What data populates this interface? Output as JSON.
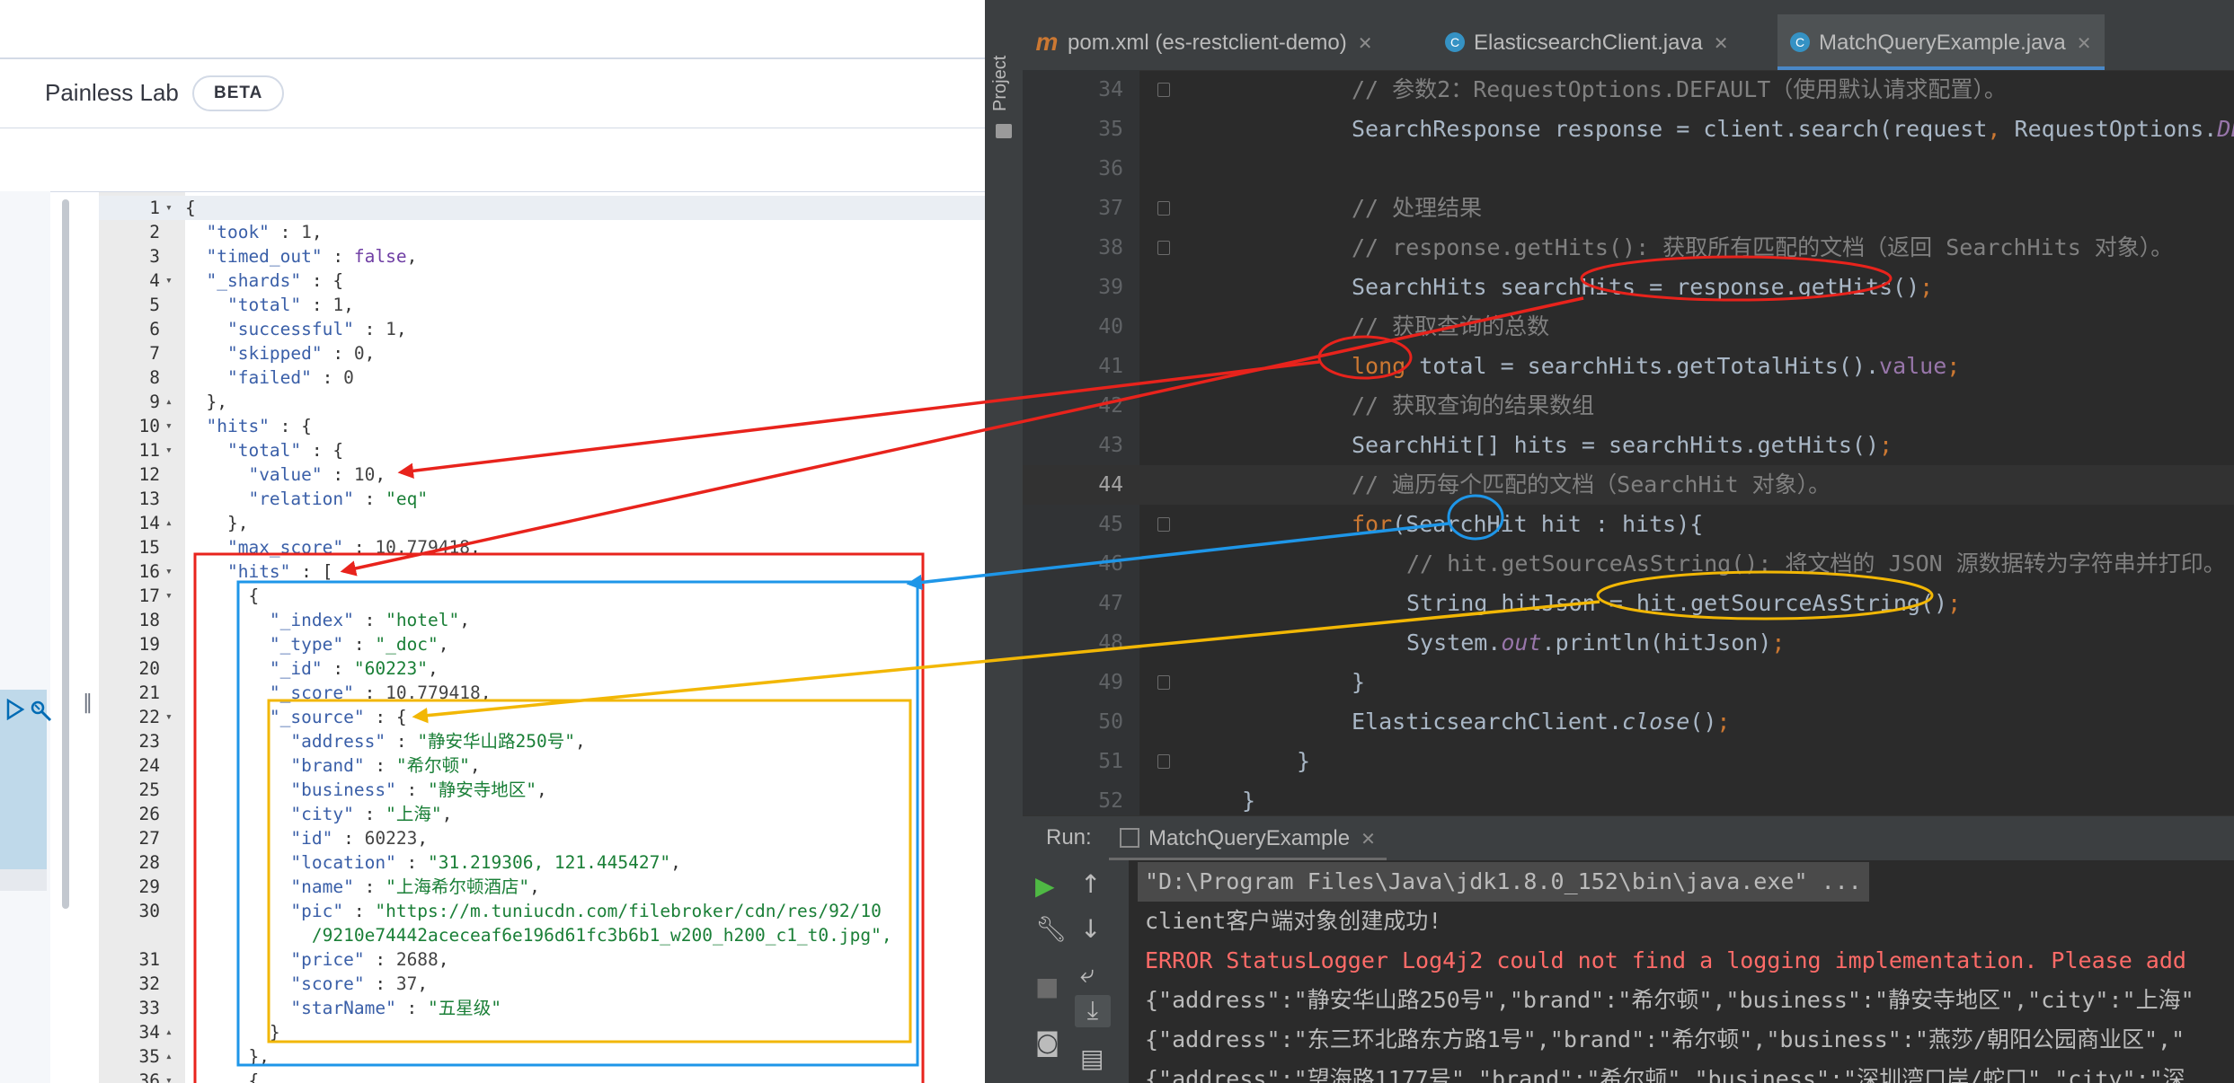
{
  "kibana": {
    "app_title": "Painless Lab",
    "beta_badge": "BETA",
    "code_lines": [
      {
        "n": "1",
        "fold": "▾",
        "t": "{"
      },
      {
        "n": "2",
        "t": "  \"took\" : 1,"
      },
      {
        "n": "3",
        "t": "  \"timed_out\" : false,"
      },
      {
        "n": "4",
        "fold": "▾",
        "t": "  \"_shards\" : {"
      },
      {
        "n": "5",
        "t": "    \"total\" : 1,"
      },
      {
        "n": "6",
        "t": "    \"successful\" : 1,"
      },
      {
        "n": "7",
        "t": "    \"skipped\" : 0,"
      },
      {
        "n": "8",
        "t": "    \"failed\" : 0"
      },
      {
        "n": "9",
        "fold": "▴",
        "t": "  },"
      },
      {
        "n": "10",
        "fold": "▾",
        "t": "  \"hits\" : {"
      },
      {
        "n": "11",
        "fold": "▾",
        "t": "    \"total\" : {"
      },
      {
        "n": "12",
        "t": "      \"value\" : 10,"
      },
      {
        "n": "13",
        "t": "      \"relation\" : \"eq\""
      },
      {
        "n": "14",
        "fold": "▴",
        "t": "    },"
      },
      {
        "n": "15",
        "t": "    \"max_score\" : 10.779418,"
      },
      {
        "n": "16",
        "fold": "▾",
        "t": "    \"hits\" : ["
      },
      {
        "n": "17",
        "fold": "▾",
        "t": "      {"
      },
      {
        "n": "18",
        "t": "        \"_index\" : \"hotel\","
      },
      {
        "n": "19",
        "t": "        \"_type\" : \"_doc\","
      },
      {
        "n": "20",
        "t": "        \"_id\" : \"60223\","
      },
      {
        "n": "21",
        "t": "        \"_score\" : 10.779418,"
      },
      {
        "n": "22",
        "fold": "▾",
        "t": "        \"_source\" : {"
      },
      {
        "n": "23",
        "t": "          \"address\" : \"静安华山路250号\","
      },
      {
        "n": "24",
        "t": "          \"brand\" : \"希尔顿\","
      },
      {
        "n": "25",
        "t": "          \"business\" : \"静安寺地区\","
      },
      {
        "n": "26",
        "t": "          \"city\" : \"上海\","
      },
      {
        "n": "27",
        "t": "          \"id\" : 60223,"
      },
      {
        "n": "28",
        "t": "          \"location\" : \"31.219306, 121.445427\","
      },
      {
        "n": "29",
        "t": "          \"name\" : \"上海希尔顿酒店\","
      },
      {
        "n": "30",
        "t": "          \"pic\" : \"https://m.tuniucdn.com/filebroker/cdn/res/92/10"
      },
      {
        "n": "",
        "t": "            /9210e74442aceceaf6e196d61fc3b6b1_w200_h200_c1_t0.jpg\","
      },
      {
        "n": "31",
        "t": "          \"price\" : 2688,"
      },
      {
        "n": "32",
        "t": "          \"score\" : 37,"
      },
      {
        "n": "33",
        "t": "          \"starName\" : \"五星级\""
      },
      {
        "n": "34",
        "fold": "▴",
        "t": "        }"
      },
      {
        "n": "35",
        "fold": "▴",
        "t": "      },"
      },
      {
        "n": "36",
        "fold": "▾",
        "t": "      {"
      }
    ]
  },
  "ide": {
    "project_label": "Project",
    "tabs": [
      {
        "icon": "m",
        "label": "pom.xml (es-restclient-demo)",
        "selected": false
      },
      {
        "icon": "c",
        "label": "ElasticsearchClient.java",
        "selected": false
      },
      {
        "icon": "c",
        "label": "MatchQueryExample.java",
        "selected": true
      }
    ],
    "code_lines": [
      {
        "n": "34",
        "indent": 2,
        "parts": [
          [
            "cm",
            "// 参数2：RequestOptions.DEFAULT（使用默认请求配置）。"
          ]
        ]
      },
      {
        "n": "35",
        "indent": 2,
        "parts": [
          [
            "d",
            "SearchResponse response = client.search(request"
          ],
          [
            "kw",
            ", "
          ],
          [
            "d",
            "RequestOptions."
          ],
          [
            "fldi",
            "DEFAULT"
          ]
        ]
      },
      {
        "n": "36",
        "indent": 0,
        "parts": []
      },
      {
        "n": "37",
        "indent": 2,
        "parts": [
          [
            "cm",
            "// 处理结果"
          ]
        ]
      },
      {
        "n": "38",
        "indent": 2,
        "parts": [
          [
            "cm",
            "// response.getHits(): 获取所有匹配的文档（返回 SearchHits 对象）。"
          ]
        ]
      },
      {
        "n": "39",
        "indent": 2,
        "parts": [
          [
            "d",
            "SearchHits searchHits = response.getHits()"
          ],
          [
            "kw",
            ";"
          ]
        ]
      },
      {
        "n": "40",
        "indent": 2,
        "parts": [
          [
            "cm",
            "// 获取查询的总数"
          ]
        ]
      },
      {
        "n": "41",
        "indent": 2,
        "parts": [
          [
            "kw",
            "long "
          ],
          [
            "d",
            "total = searchHits.getTotalHits()."
          ],
          [
            "fld",
            "value"
          ],
          [
            "kw",
            ";"
          ]
        ]
      },
      {
        "n": "42",
        "indent": 2,
        "parts": [
          [
            "cm",
            "// 获取查询的结果数组"
          ]
        ]
      },
      {
        "n": "43",
        "indent": 2,
        "parts": [
          [
            "d",
            "SearchHit[] hits = searchHits.getHits()"
          ],
          [
            "kw",
            ";"
          ]
        ]
      },
      {
        "n": "44",
        "indent": 2,
        "cur": true,
        "parts": [
          [
            "cm",
            "// 遍历每个匹配的文档（SearchHit 对象）。"
          ]
        ]
      },
      {
        "n": "45",
        "indent": 2,
        "parts": [
          [
            "kw",
            "for"
          ],
          [
            "d",
            "(SearchHit hit : hits){"
          ]
        ]
      },
      {
        "n": "46",
        "indent": 3,
        "parts": [
          [
            "cm",
            "// hit.getSourceAsString(): 将文档的 JSON 源数据转为字符串并打印。"
          ]
        ]
      },
      {
        "n": "47",
        "indent": 3,
        "parts": [
          [
            "d",
            "String hitJson = hit.getSourceAsString()"
          ],
          [
            "kw",
            ";"
          ]
        ]
      },
      {
        "n": "48",
        "indent": 3,
        "parts": [
          [
            "d",
            "System."
          ],
          [
            "fldi",
            "out"
          ],
          [
            "d",
            ".println(hitJson)"
          ],
          [
            "kw",
            ";"
          ]
        ]
      },
      {
        "n": "49",
        "indent": 2,
        "parts": [
          [
            "d",
            "}"
          ]
        ]
      },
      {
        "n": "50",
        "indent": 2,
        "parts": [
          [
            "d",
            "ElasticsearchClient."
          ],
          [
            "it",
            "close"
          ],
          [
            "d",
            "()"
          ],
          [
            "kw",
            ";"
          ]
        ]
      },
      {
        "n": "51",
        "indent": 1,
        "parts": [
          [
            "d",
            "}"
          ]
        ]
      },
      {
        "n": "52",
        "indent": 0,
        "parts": [
          [
            "d",
            "}"
          ]
        ]
      }
    ],
    "run_label": "Run:",
    "run_tab": "MatchQueryExample",
    "output_lines": [
      {
        "t": "\"D:\\Program Files\\Java\\jdk1.8.0_152\\bin\\java.exe\" ...",
        "cls": "hl"
      },
      {
        "t": "client客户端对象创建成功!",
        "cls": ""
      },
      {
        "t": "ERROR StatusLogger Log4j2 could not find a logging implementation. Please add",
        "cls": "err"
      },
      {
        "t": "{\"address\":\"静安华山路250号\",\"brand\":\"希尔顿\",\"business\":\"静安寺地区\",\"city\":\"上海\"",
        "cls": ""
      },
      {
        "t": "{\"address\":\"东三环北路东方路1号\",\"brand\":\"希尔顿\",\"business\":\"燕莎/朝阳公园商业区\",\"",
        "cls": ""
      },
      {
        "t": "{\"address\":\"望海路1177号\",\"brand\":\"希尔顿\",\"business\":\"深圳湾口岸/蛇口\",\"city\":\"深",
        "cls": ""
      }
    ]
  },
  "colors": {
    "annot_red": "#e8231c",
    "annot_blue": "#1e96e8",
    "annot_yellow": "#f2b705"
  }
}
